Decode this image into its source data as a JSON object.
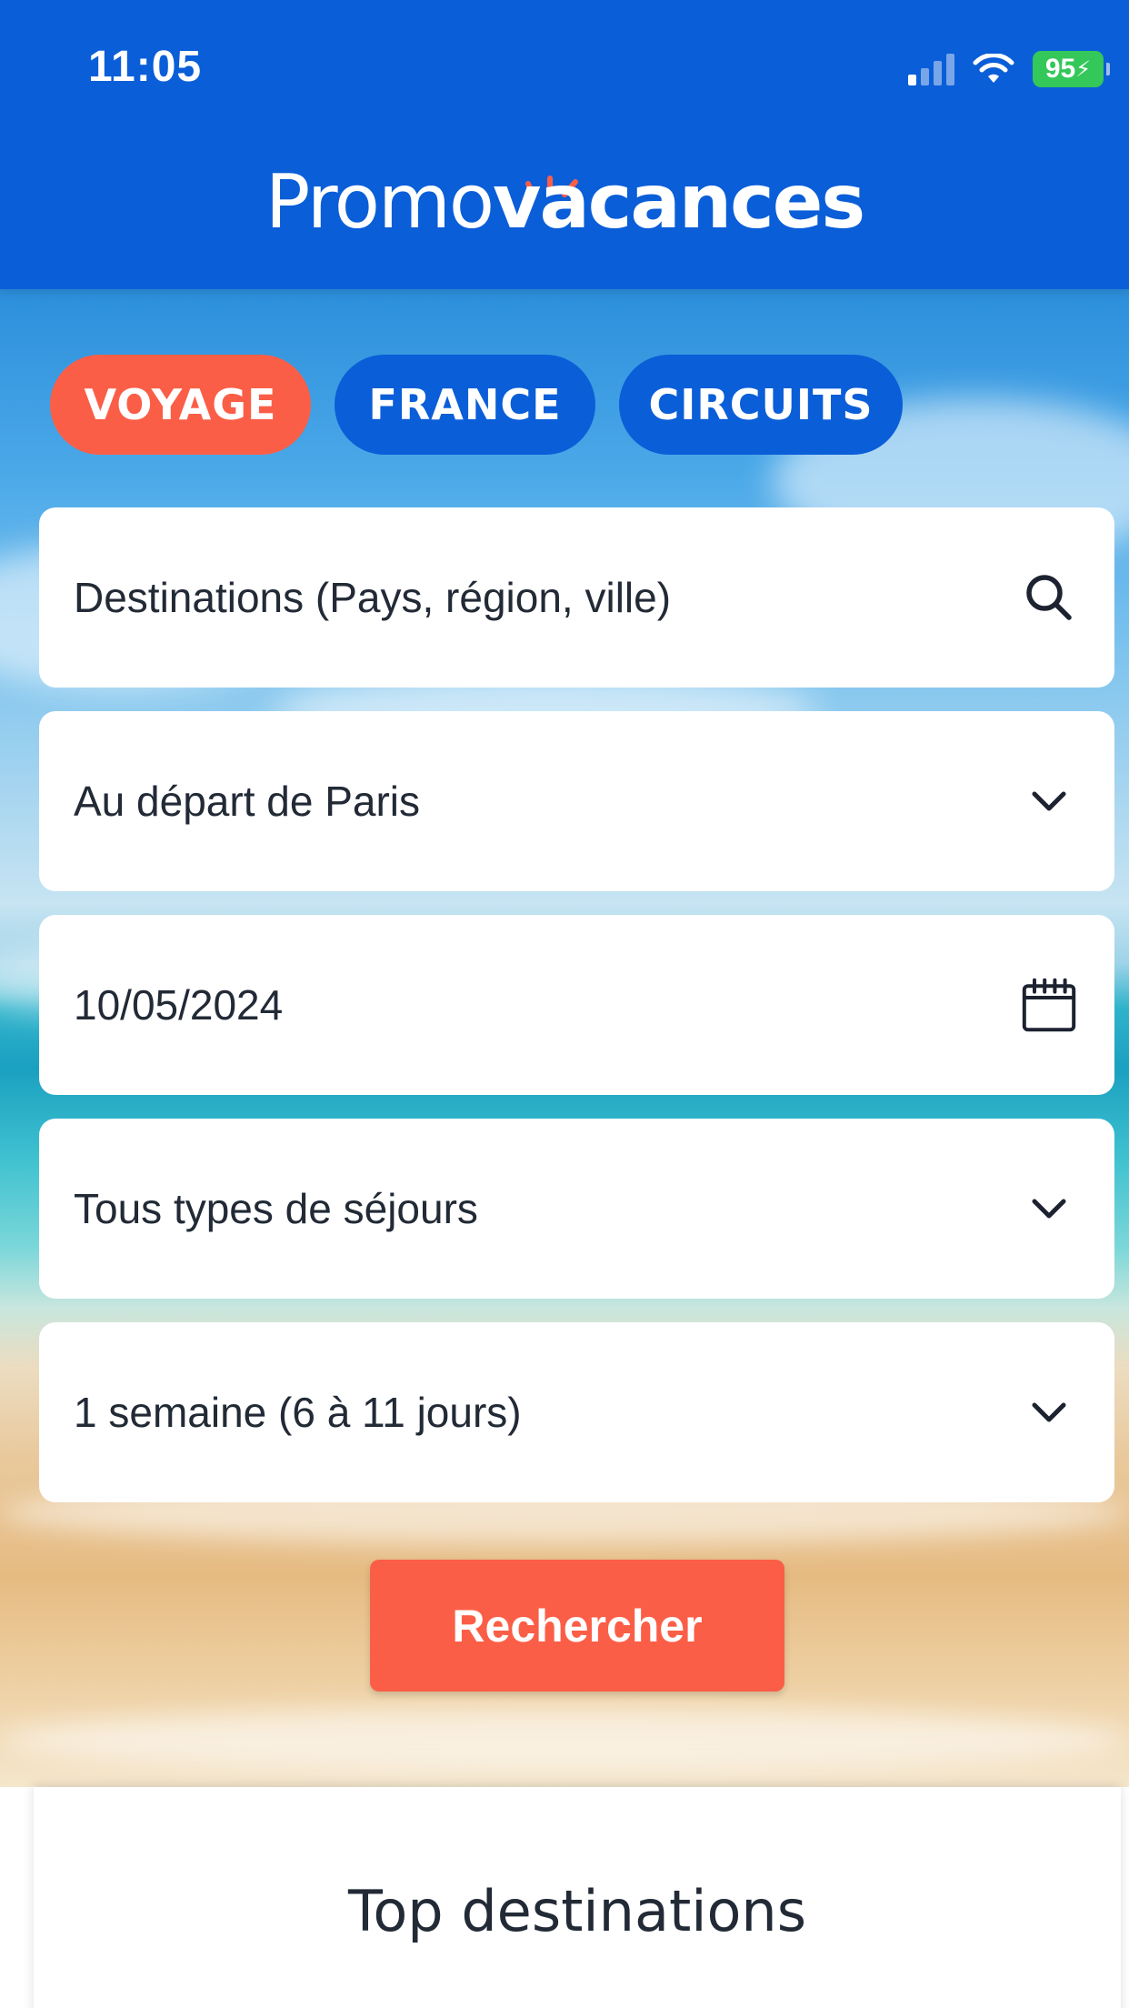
{
  "status_bar": {
    "time": "11:05",
    "battery": "95"
  },
  "header": {
    "logo_light": "Promo",
    "logo_bold": "vacances"
  },
  "tabs": [
    {
      "label": "VOYAGE",
      "active": true
    },
    {
      "label": "FRANCE",
      "active": false
    },
    {
      "label": "CIRCUITS",
      "active": false
    }
  ],
  "form": {
    "destination": {
      "placeholder": "Destinations (Pays, région, ville)",
      "icon": "search-icon"
    },
    "departure": {
      "value": "Au départ de Paris",
      "icon": "chevron-down-icon"
    },
    "date": {
      "value": "10/05/2024",
      "icon": "calendar-icon"
    },
    "stay_type": {
      "value": "Tous types de séjours",
      "icon": "chevron-down-icon"
    },
    "duration": {
      "value": "1 semaine (6 à 11 jours)",
      "icon": "chevron-down-icon"
    },
    "search_label": "Rechercher"
  },
  "section": {
    "title": "Top destinations"
  },
  "colors": {
    "brand_blue": "#0a5ed8",
    "accent_orange": "#fb5e47",
    "battery_green": "#34c759"
  }
}
